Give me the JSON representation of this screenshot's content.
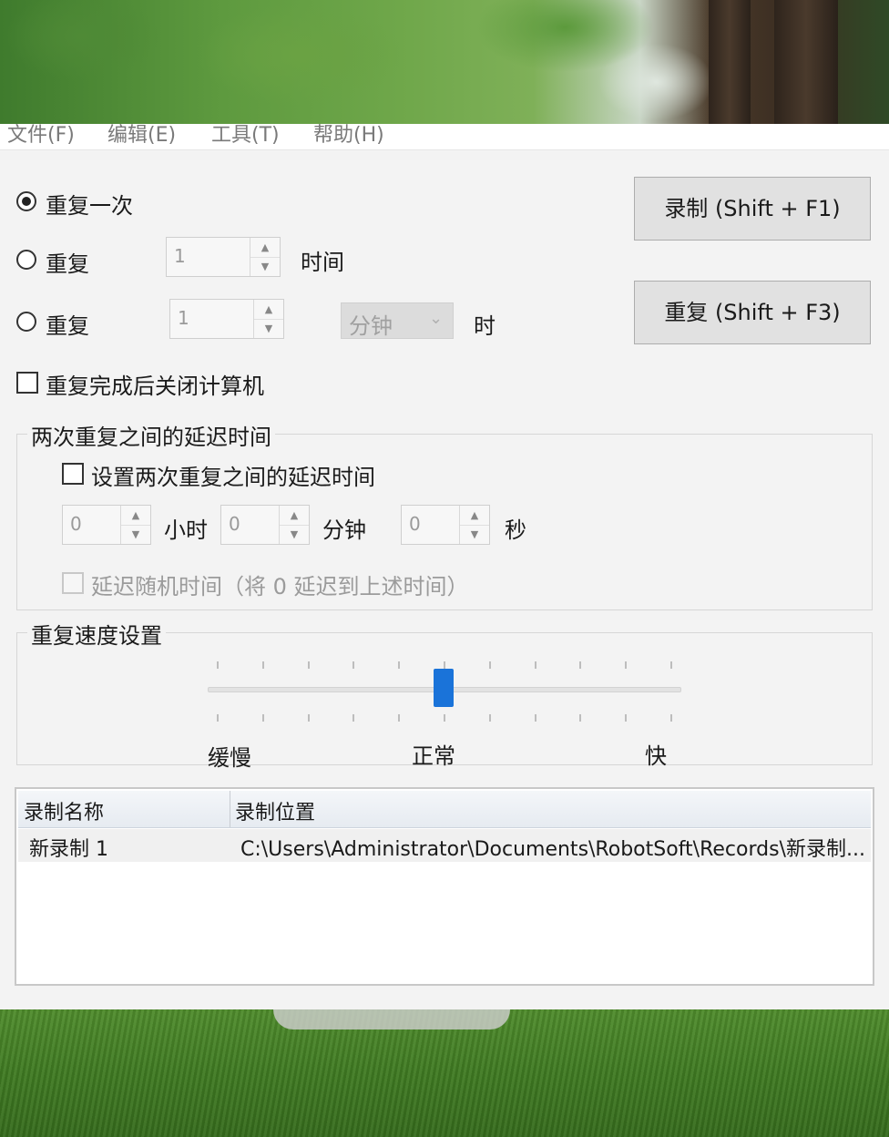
{
  "menu": [
    "文件(F)",
    "编辑(E)",
    "工具(T)",
    "帮助(H)"
  ],
  "options": {
    "repeat_once": "重复一次",
    "repeat_times_label": "重复",
    "repeat_times_value": "1",
    "repeat_times_unit": "时间",
    "repeat_duration_label": "重复",
    "repeat_duration_value": "1",
    "repeat_duration_select": "分钟",
    "repeat_duration_unit": "时",
    "shutdown_after": "重复完成后关闭计算机"
  },
  "buttons": {
    "record": "录制 (Shift + F1)",
    "repeat": "重复 (Shift + F3)"
  },
  "delay_group": {
    "title": "两次重复之间的延迟时间",
    "enable_label": "设置两次重复之间的延迟时间",
    "hours_value": "0",
    "hours_unit": "小时",
    "minutes_value": "0",
    "minutes_unit": "分钟",
    "seconds_value": "0",
    "seconds_unit": "秒",
    "random_label": "延迟随机时间（将 0 延迟到上述时间）"
  },
  "speed_group": {
    "title": "重复速度设置",
    "slow": "缓慢",
    "normal": "正常",
    "fast": "快",
    "ticks": 11,
    "position": 5
  },
  "recordings": {
    "columns": [
      "录制名称",
      "录制位置"
    ],
    "rows": [
      {
        "name": "新录制 1",
        "path": "C:\\Users\\Administrator\\Documents\\RobotSoft\\Records\\新录制..."
      }
    ]
  },
  "colors": {
    "slider_thumb": "#1a73d9",
    "dialog_bg": "#f3f3f3"
  }
}
